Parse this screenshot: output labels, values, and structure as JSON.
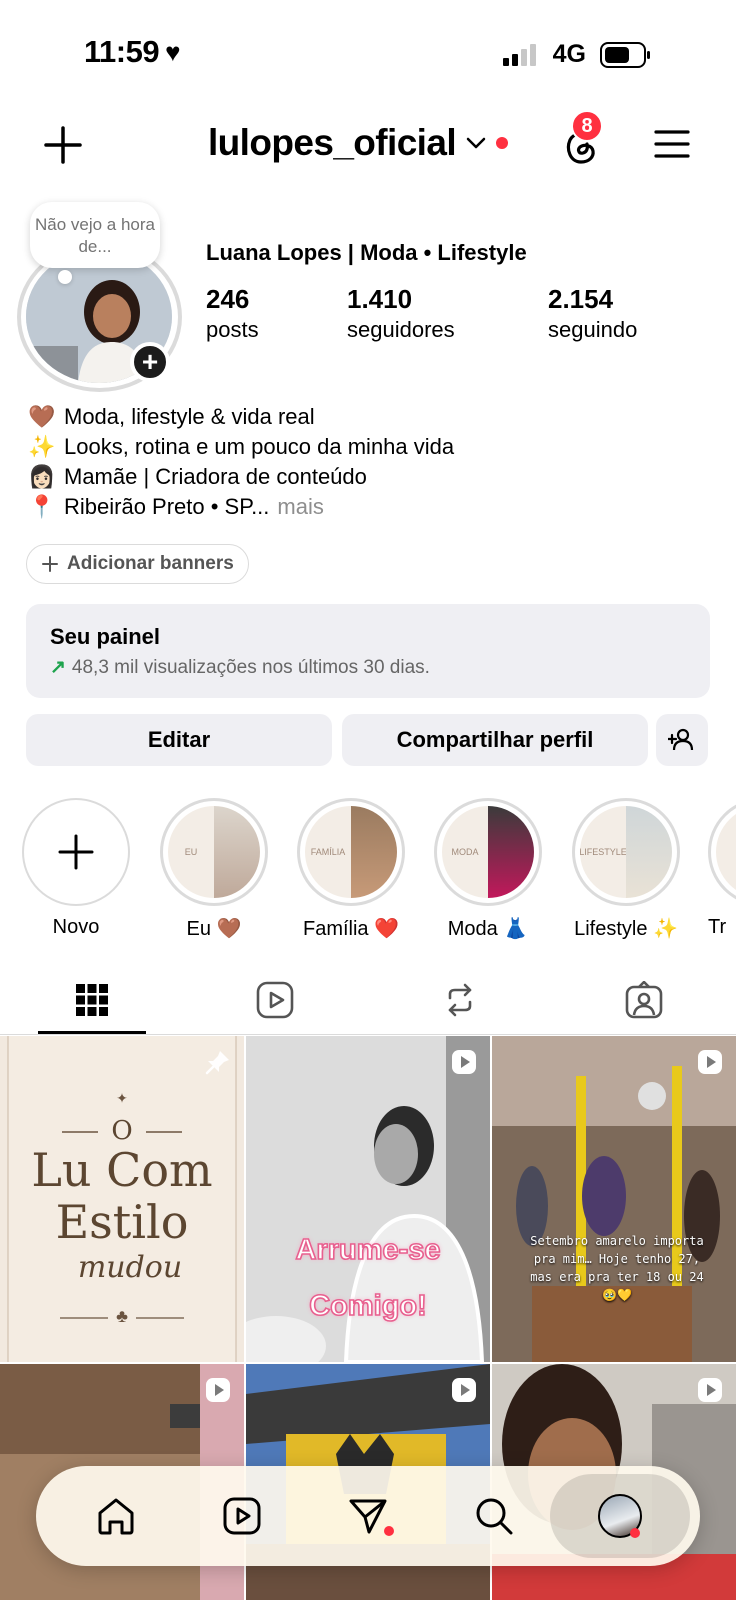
{
  "status_bar": {
    "time": "11:59",
    "network": "4G"
  },
  "header": {
    "username": "lulopes_oficial",
    "notification_count": "8"
  },
  "note": {
    "text": "Não vejo a hora de..."
  },
  "profile": {
    "name": "Luana Lopes | Moda • Lifestyle",
    "stats": [
      {
        "value": "246",
        "label": "posts"
      },
      {
        "value": "1.410",
        "label": "seguidores"
      },
      {
        "value": "2.154",
        "label": "seguindo"
      }
    ],
    "bio": [
      {
        "emoji": "🤎",
        "text": "Moda, lifestyle & vida real"
      },
      {
        "emoji": "✨",
        "text": "Looks, rotina e um pouco da minha vida"
      },
      {
        "emoji": "👩🏻",
        "text": "Mamãe | Criadora de conteúdo"
      },
      {
        "emoji": "📍",
        "text": "Ribeirão Preto • SP...",
        "more": "mais"
      }
    ]
  },
  "banner_button": "Adicionar banners",
  "dashboard": {
    "title": "Seu painel",
    "subtitle": "48,3 mil visualizações nos últimos 30 dias."
  },
  "actions": {
    "edit": "Editar",
    "share": "Compartilhar perfil"
  },
  "highlights": [
    {
      "label": "Novo"
    },
    {
      "label": "Eu 🤎",
      "tag": "EU"
    },
    {
      "label": "Família ❤️",
      "tag": "FAMÍLIA"
    },
    {
      "label": "Moda 👗",
      "tag": "MODA"
    },
    {
      "label": "Lifestyle ✨",
      "tag": "LIFESTYLE"
    },
    {
      "label": "Tr"
    }
  ],
  "posts": [
    {
      "line1": "O",
      "line2": "Lu Com",
      "line3": "Estilo",
      "line4": "mudou"
    },
    {
      "line1": "Arrume-se",
      "line2": "Comigo!"
    },
    {
      "text": "Setembro amarelo importa pra mim… Hoje tenho 27, mas era pra ter 18 ou 24 🥹💛"
    }
  ],
  "colors": {
    "accent_red": "#ff3040",
    "panel_gray": "#efeff3",
    "trend_green": "#1ea34d"
  }
}
